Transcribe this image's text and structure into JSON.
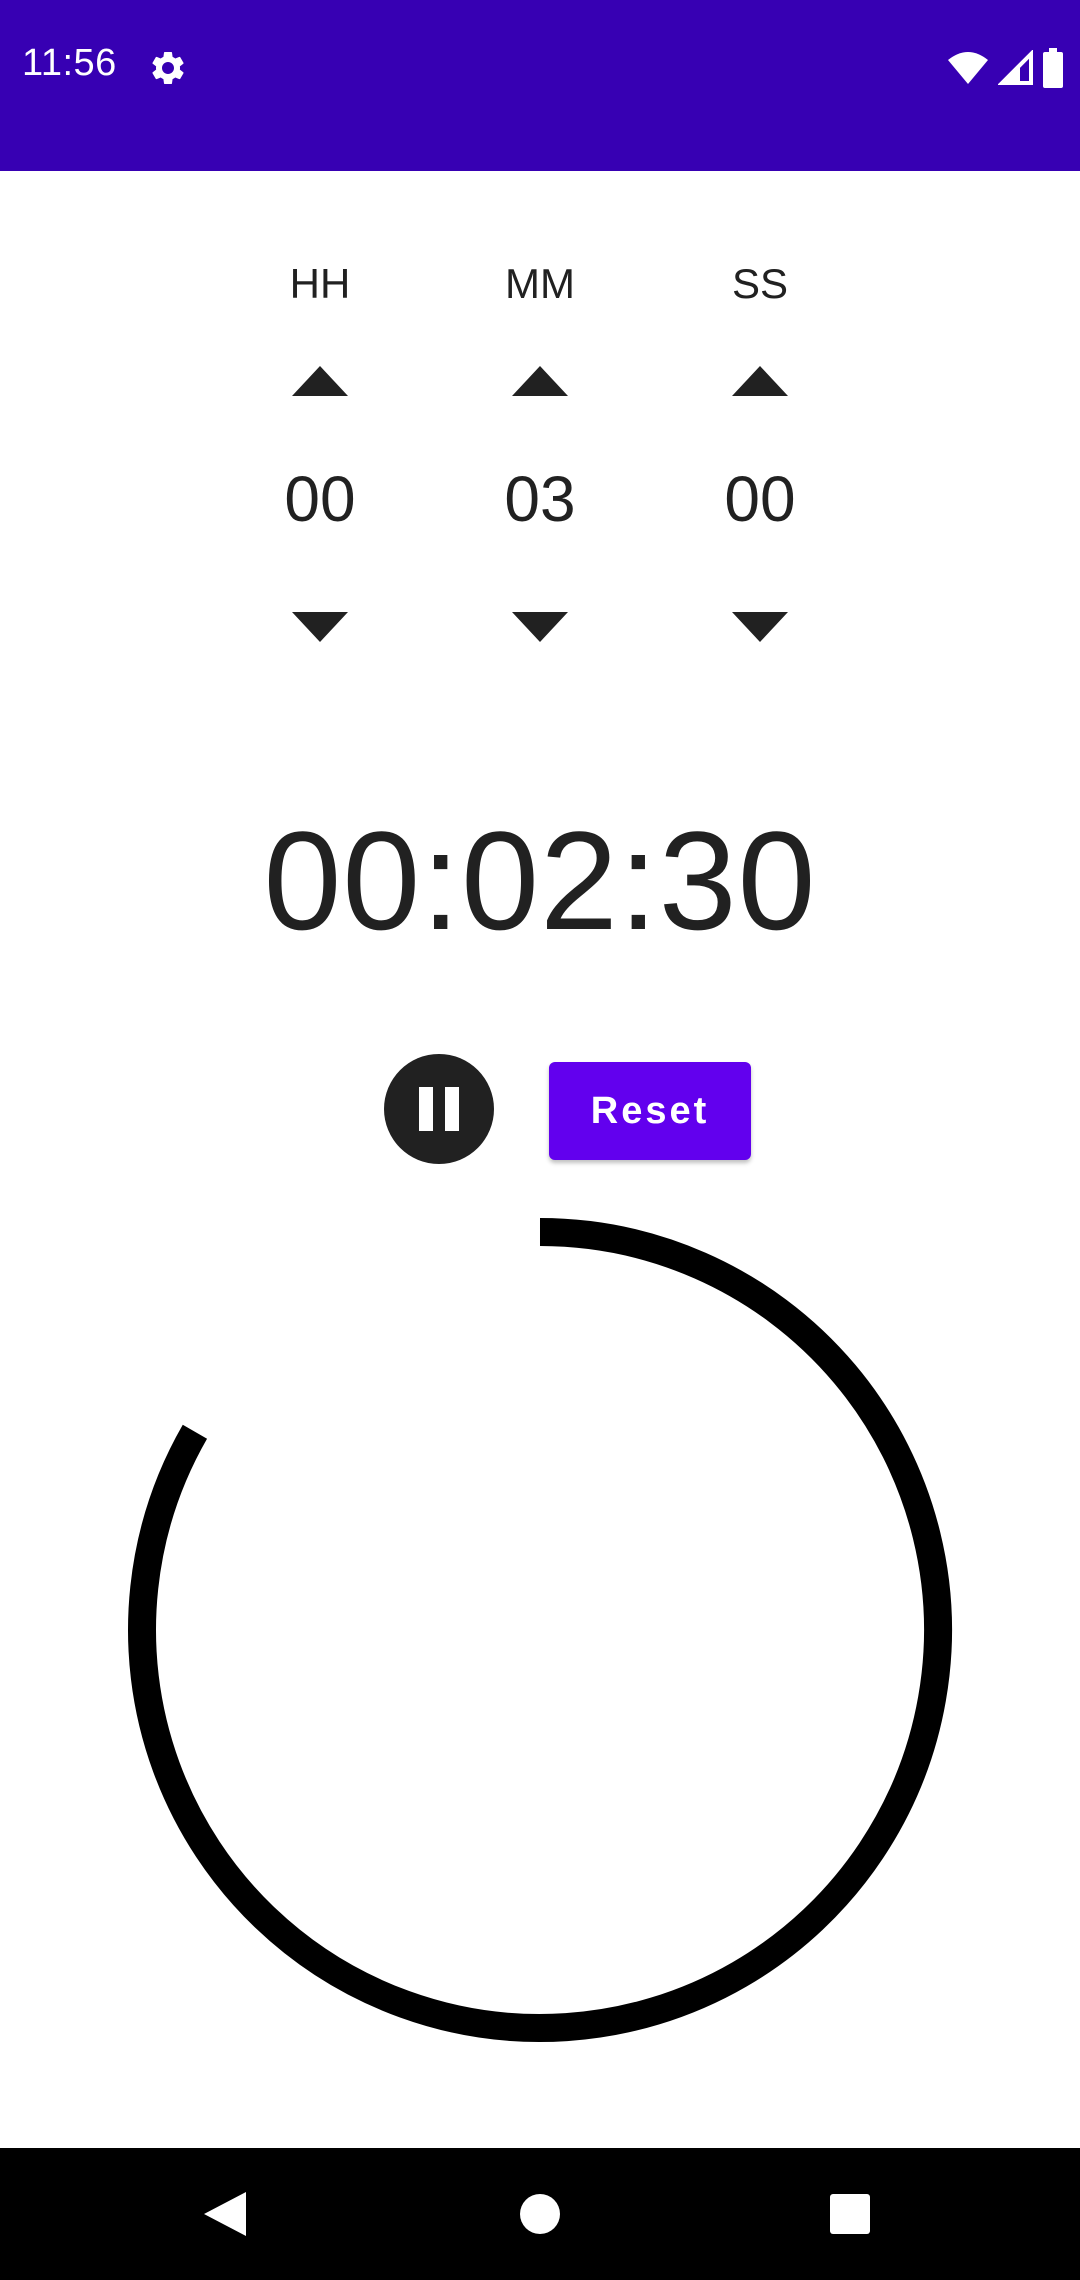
{
  "status_bar": {
    "time": "11:56",
    "background_color": "#3700b3",
    "icons": [
      "settings-gear-icon",
      "wifi-icon",
      "cell-signal-icon",
      "battery-icon"
    ]
  },
  "pickers": [
    {
      "label": "HH",
      "value": "00"
    },
    {
      "label": "MM",
      "value": "03"
    },
    {
      "label": "SS",
      "value": "00"
    }
  ],
  "countdown": {
    "display": "00:02:30"
  },
  "controls": {
    "pause_icon": "pause-icon",
    "reset_label": "Reset",
    "accent_color": "#6200ee"
  },
  "progress": {
    "remaining_fraction": 0.833
  },
  "nav_bar": {
    "buttons": [
      "back-icon",
      "home-icon",
      "recents-icon"
    ]
  }
}
